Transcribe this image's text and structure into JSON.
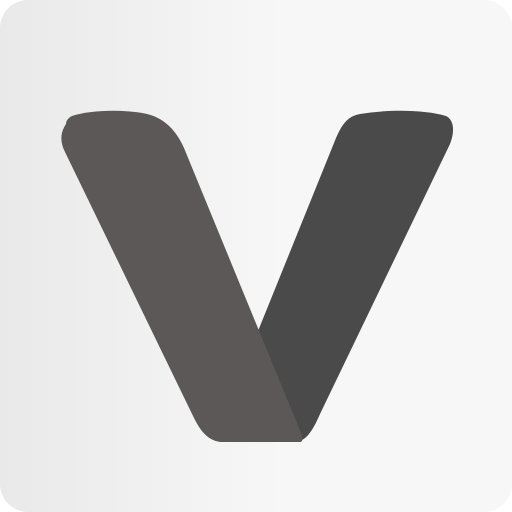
{
  "icon": {
    "name": "v-logo-icon",
    "letter": "V",
    "colors": {
      "background_left": "#e9e9e9",
      "background_right": "#f7f7f7",
      "left_stroke": "#5c5857",
      "right_stroke": "#4a4a4a"
    }
  }
}
